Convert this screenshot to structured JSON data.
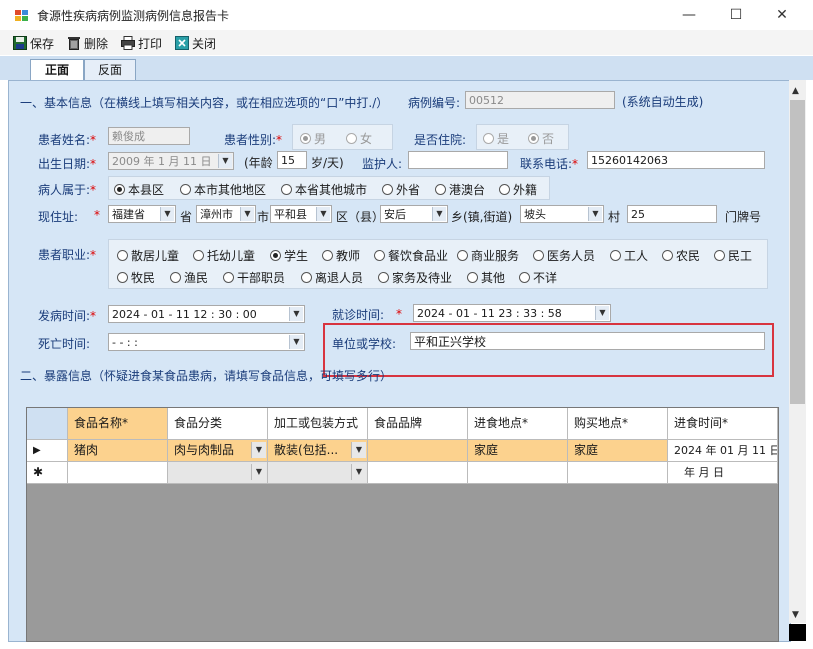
{
  "window": {
    "title": "食源性疾病病例监测病例信息报告卡",
    "minimize": "—",
    "maximize": "☐",
    "close": "✕"
  },
  "toolbar": {
    "save": "保存",
    "delete": "删除",
    "print": "打印",
    "close": "关闭"
  },
  "tabs": {
    "front": "正面",
    "back": "反面"
  },
  "section1": {
    "title": "一、基本信息（在横线上填写相关内容，或在相应选项的“口”中打./）",
    "case_no_label": "病例编号:",
    "case_no_value": "00512",
    "case_no_note": "(系统自动生成)"
  },
  "patient": {
    "name_label": "患者姓名:",
    "name_value": "赖俊成",
    "gender_label": "患者性别:",
    "gender_male": "男",
    "gender_female": "女",
    "inpatient_label": "是否住院:",
    "inpatient_yes": "是",
    "inpatient_no": "否",
    "dob_label": "出生日期:",
    "dob_value": "2009 年 1 月 11 日",
    "age_label": "(年龄",
    "age_value": "15",
    "age_unit": "岁/天)",
    "guardian_label": "监护人:",
    "guardian_value": "",
    "phone_label": "联系电话:",
    "phone_value": "15260142063",
    "belong_label": "病人属于:",
    "belong_options": [
      "本县区",
      "本市其他地区",
      "本省其他城市",
      "外省",
      "港澳台",
      "外籍"
    ],
    "addr_label": "现住址:",
    "province": "福建省",
    "province_unit": "省",
    "city": "漳州市",
    "city_unit": "市",
    "county": "平和县",
    "county_unit": "区（县）",
    "town": "安后",
    "town_unit": "乡(镇,街道)",
    "village": "坡头",
    "village_unit": "村",
    "house_no": "25",
    "house_unit": "门牌号",
    "occupation_label": "患者职业:",
    "occupations_row1": [
      "散居儿童",
      "托幼儿童",
      "学生",
      "教师",
      "餐饮食品业",
      "商业服务",
      "医务人员",
      "工人",
      "农民",
      "民工"
    ],
    "occupations_row2": [
      "牧民",
      "渔民",
      "干部职员",
      "离退人员",
      "家务及待业",
      "其他",
      "不详"
    ],
    "onset_label": "发病时间:",
    "onset_value": "2024 - 01 - 11    12 : 30 : 00",
    "visit_label": "就诊时间:",
    "visit_value": "2024 - 01 - 11    23 : 33 : 58",
    "death_label": "死亡时间:",
    "death_value": "    -   -         :     :",
    "unit_label": "单位或学校:",
    "unit_value": "平和正兴学校"
  },
  "section2": {
    "title": "二、暴露信息（怀疑进食某食品患病，请填写食品信息，可填写多行）"
  },
  "grid": {
    "columns": [
      "食品名称*",
      "食品分类",
      "加工或包装方式",
      "食品品牌",
      "进食地点*",
      "购买地点*",
      "进食时间*"
    ],
    "row1": {
      "indicator": "▶",
      "food_name": "猪肉",
      "category": "肉与肉制品",
      "processing": "散装(包括...",
      "brand": "",
      "eat_place": "家庭",
      "buy_place": "家庭",
      "eat_time": "2024 年 01 月 11 日"
    },
    "row2": {
      "indicator": "✱",
      "eat_time": "年   月   日"
    }
  }
}
